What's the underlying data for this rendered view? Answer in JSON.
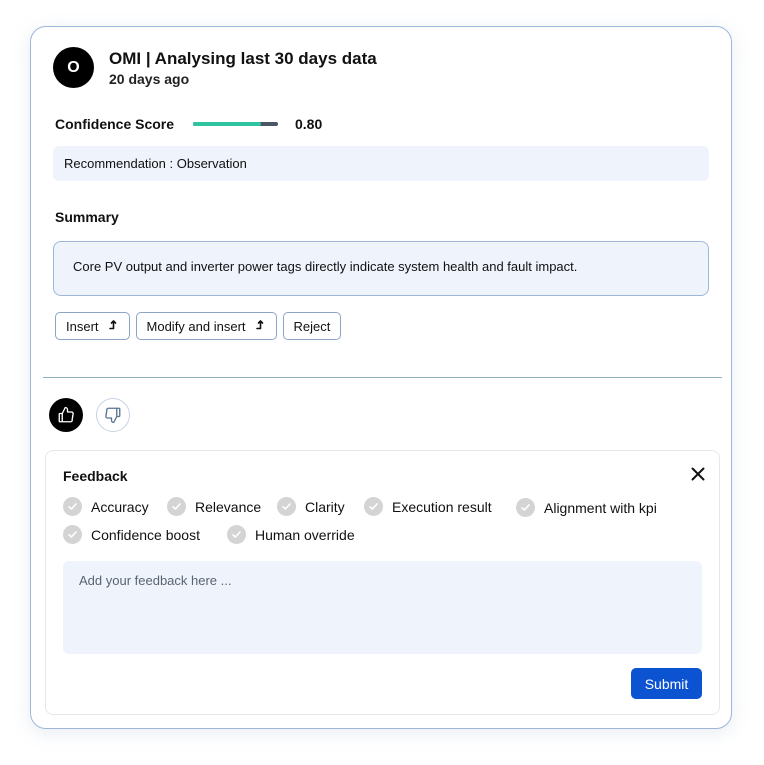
{
  "header": {
    "avatar_letter": "O",
    "title": "OMI | Analysing last 30 days data",
    "time": "20 days ago"
  },
  "confidence": {
    "label": "Confidence Score",
    "value_text": "0.80",
    "value": 0.8
  },
  "recommendation": "Recommendation : Observation",
  "summary": {
    "label": "Summary",
    "text": "Core PV output and inverter power tags directly indicate system health and fault impact."
  },
  "actions": {
    "insert": "Insert",
    "modify_insert": "Modify and insert",
    "reject": "Reject"
  },
  "feedback": {
    "title": "Feedback",
    "options": [
      "Accuracy",
      "Relevance",
      "Clarity",
      "Execution result",
      "Alignment with kpi",
      "Confidence boost",
      "Human override"
    ],
    "placeholder": "Add your feedback here ...",
    "submit": "Submit"
  },
  "colors": {
    "accent": "#0b53d1",
    "progress": "#2ec4a0",
    "panel_bg": "#eef3fc",
    "border": "#9db7d9"
  }
}
